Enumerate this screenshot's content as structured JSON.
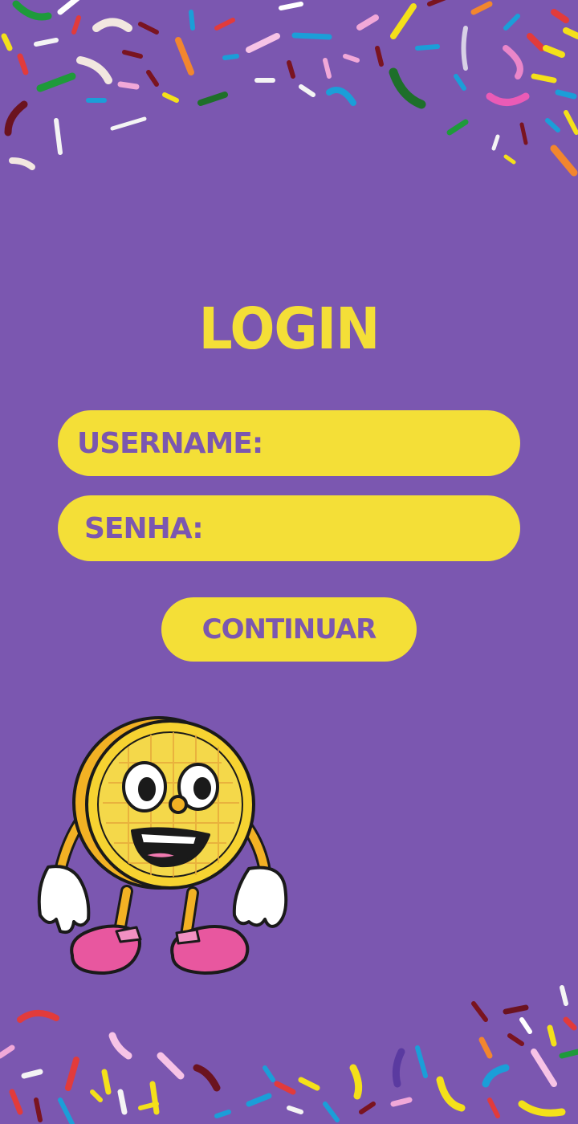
{
  "page": {
    "title": "LOGIN"
  },
  "form": {
    "username_label": "USERNAME:",
    "username_value": "",
    "password_label": "SENHA:",
    "password_value": "",
    "continue_label": "CONTINUAR"
  },
  "decor": {
    "mascot": "waffle-mascot-icon",
    "sprinkles": "sprinkles-decoration"
  },
  "colors": {
    "background": "#7b57b0",
    "accent": "#f4df37"
  }
}
